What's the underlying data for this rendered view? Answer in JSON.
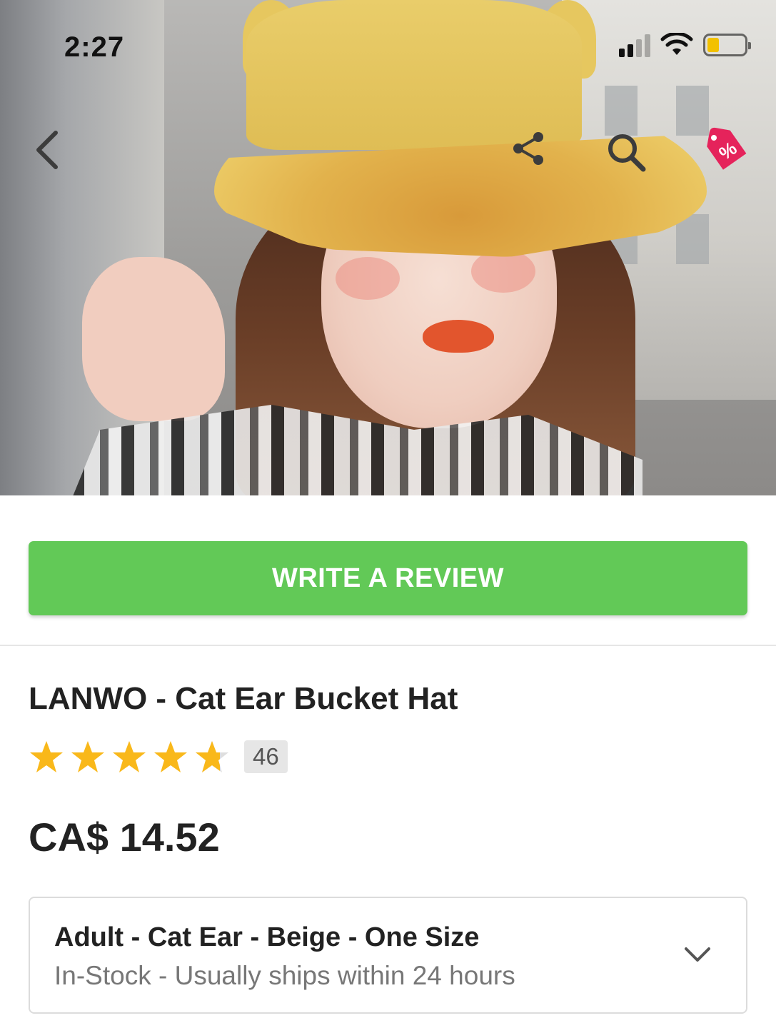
{
  "status_bar": {
    "time": "2:27",
    "battery_color": "#f2c100"
  },
  "nav": {
    "icons": [
      "back-icon",
      "share-icon",
      "search-icon",
      "discount-tag-icon"
    ],
    "discount_color": "#e5235b"
  },
  "hero": {
    "image": "model-wearing-yellow-cat-ear-bucket-hat"
  },
  "review_button": {
    "label": "WRITE A REVIEW",
    "color": "#62c957"
  },
  "product": {
    "title": "LANWO - Cat Ear Bucket Hat",
    "rating": 4.8,
    "rating_max": 5,
    "review_count": "46",
    "price": "CA$ 14.52",
    "star_color": "#f9b81a"
  },
  "variant": {
    "selected": "Adult - Cat Ear - Beige - One Size",
    "stock": "In-Stock - Usually ships within 24 hours"
  }
}
